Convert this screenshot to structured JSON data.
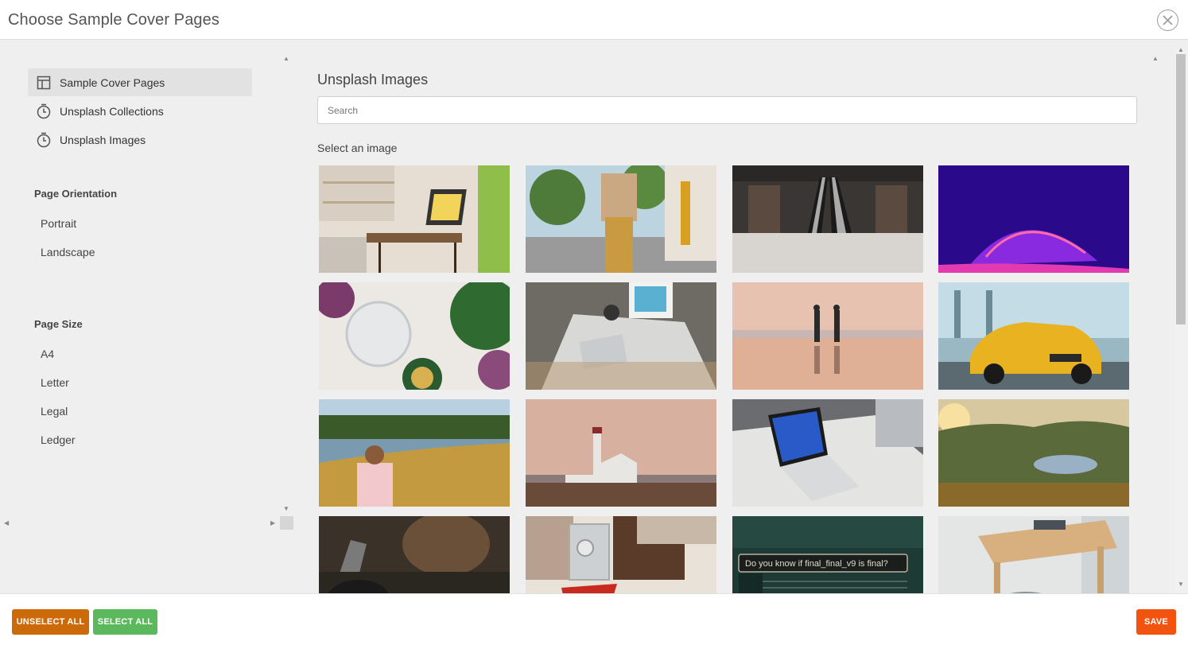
{
  "dialog": {
    "title": "Choose Sample Cover Pages"
  },
  "sidebar": {
    "nav": [
      {
        "label": "Sample Cover Pages",
        "icon": "layout-icon",
        "active": true
      },
      {
        "label": "Unsplash Collections",
        "icon": "clock-icon",
        "active": false
      },
      {
        "label": "Unsplash Images",
        "icon": "clock-icon",
        "active": false
      }
    ],
    "orientation": {
      "title": "Page Orientation",
      "options": [
        "Portrait",
        "Landscape"
      ]
    },
    "size": {
      "title": "Page Size",
      "options": [
        "A4",
        "Letter",
        "Legal",
        "Ledger"
      ]
    }
  },
  "content": {
    "title": "Unsplash Images",
    "search_placeholder": "Search",
    "search_value": "",
    "select_label": "Select an image",
    "images": [
      {
        "alt": "laptop-on-desk-photo"
      },
      {
        "alt": "street-person-photo"
      },
      {
        "alt": "escalator-photo"
      },
      {
        "alt": "purple-abstract-photo"
      },
      {
        "alt": "glass-and-flowers-photo"
      },
      {
        "alt": "desk-with-tablet-photo"
      },
      {
        "alt": "couple-on-beach-photo"
      },
      {
        "alt": "yellow-car-photo"
      },
      {
        "alt": "child-by-lake-photo"
      },
      {
        "alt": "lighthouse-photo"
      },
      {
        "alt": "laptop-on-white-table-photo"
      },
      {
        "alt": "mountain-lake-photo"
      },
      {
        "alt": "hands-with-tool-photo"
      },
      {
        "alt": "hands-with-camera-photo"
      },
      {
        "alt": "chat-bubble-photo",
        "caption": "Do you know if final_final_v9 is final?"
      },
      {
        "alt": "wooden-desk-photo"
      }
    ]
  },
  "footer": {
    "unselect_all": "UNSELECT ALL",
    "select_all": "SELECT ALL",
    "save": "SAVE"
  },
  "colors": {
    "unselect": "#cc6a0a",
    "select": "#5cb85c",
    "save": "#f25410"
  }
}
